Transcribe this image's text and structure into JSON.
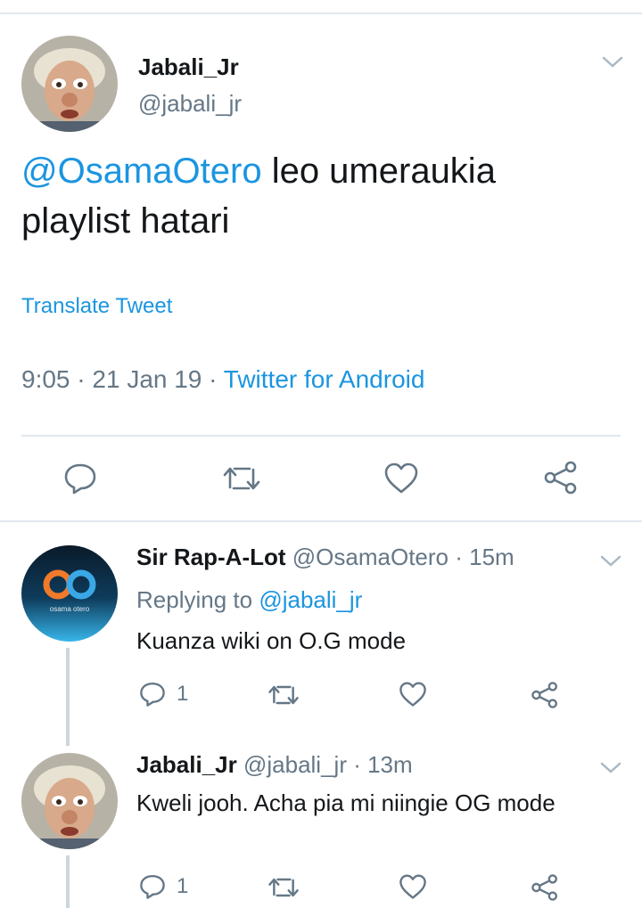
{
  "main_tweet": {
    "author_name": "Jabali_Jr",
    "author_handle": "@jabali_jr",
    "mention": "@OsamaOtero",
    "text": " leo umeraukia playlist hatari",
    "translate_label": "Translate Tweet",
    "time": "9:05",
    "date": "21 Jan 19",
    "separator": " · ",
    "source": "Twitter for Android",
    "actions": [
      "reply-icon",
      "retweet-icon",
      "like-icon",
      "share-icon"
    ]
  },
  "replies": [
    {
      "author_name": "Sir Rap-A-Lot",
      "author_handle": "@OsamaOtero",
      "time_ago": "15m",
      "replying_prefix": "Replying to ",
      "replying_to": "@jabali_jr",
      "text": "Kuanza wiki on O.G mode",
      "reply_count": "1",
      "avatar_label": "osama otero"
    },
    {
      "author_name": "Jabali_Jr",
      "author_handle": "@jabali_jr",
      "time_ago": "13m",
      "text": "Kweli jooh.  Acha pia mi niingie OG mode",
      "reply_count": "1"
    }
  ],
  "colors": {
    "link": "#1b95e0",
    "secondary": "#657786",
    "primary_text": "#14171a",
    "divider": "#e1e8ed",
    "thread_line": "#ccd6dd"
  }
}
